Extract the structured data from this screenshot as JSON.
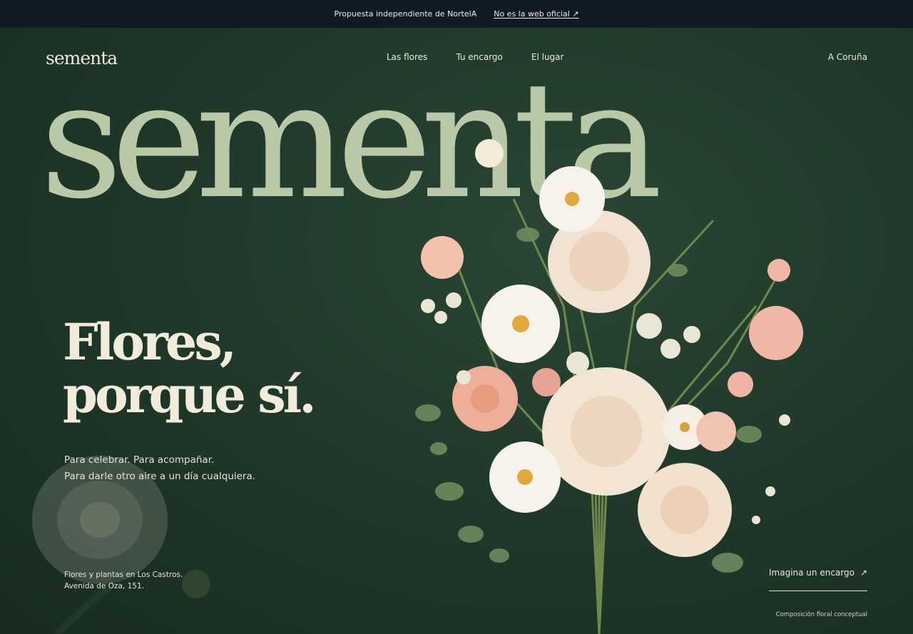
{
  "topbar": {
    "note": "Propuesta independiente de NortelA",
    "link": "No es la web oficial ↗"
  },
  "header": {
    "logo": "sementa",
    "nav": [
      "Las flores",
      "Tu encargo",
      "El lugar"
    ],
    "city": "A Coruña"
  },
  "hero": {
    "big_word": "sementa",
    "headline_line1": "Flores,",
    "headline_line2": "porque sí.",
    "sub_line1": "Para celebrar. Para acompañar.",
    "sub_line2": "Para darle otro aire a un día cualquiera.",
    "address_line1": "Flores y plantas en Los Castros.",
    "address_line2": "Avenida de Oza, 151.",
    "cta_label": "Imagina un encargo",
    "cta_icon": "↗",
    "caption": "Composición floral conceptual"
  },
  "colors": {
    "background": "#1e3527",
    "topbar": "#0f1a24",
    "big_word": "#b9c8a7",
    "text": "#efe9dc"
  }
}
